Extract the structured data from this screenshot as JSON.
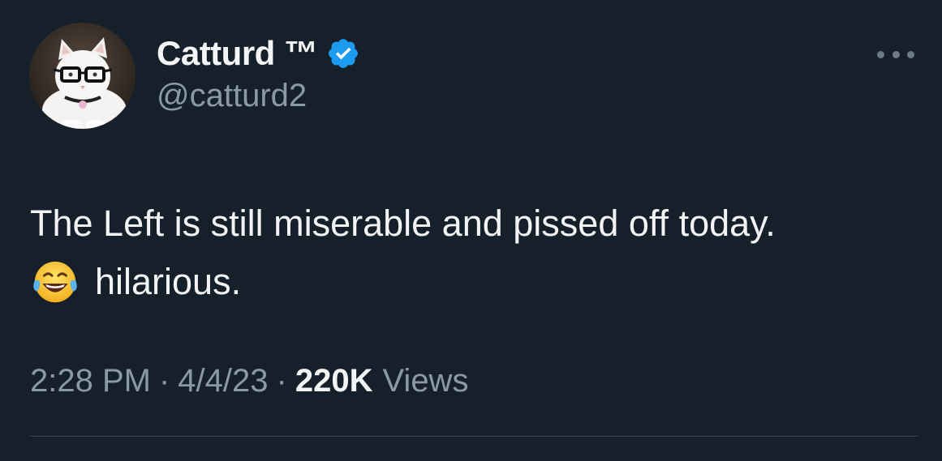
{
  "author": {
    "display_name": "Catturd ™",
    "handle": "@catturd2",
    "verified_color": "#1d9bf0"
  },
  "tweet": {
    "text_line1": "The Left is still miserable and pissed off today.",
    "emoji": "face-with-tears-of-joy",
    "text_line2": "hilarious."
  },
  "meta": {
    "time": "2:28 PM",
    "separator": "·",
    "date": "4/4/23",
    "views_count": "220K",
    "views_label": "Views"
  },
  "icons": {
    "more": "more-horizontal-icon",
    "verified": "verified-badge-icon"
  },
  "colors": {
    "background": "#16202b",
    "text_primary": "#f2f3f4",
    "text_secondary": "#8b98a5"
  }
}
